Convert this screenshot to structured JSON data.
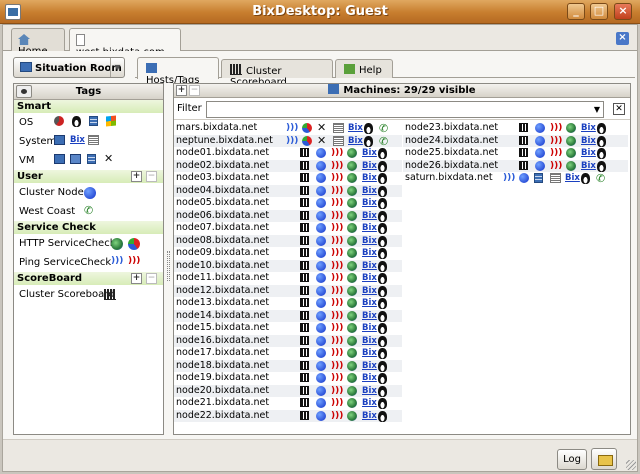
{
  "window": {
    "title": "BixDesktop: Guest"
  },
  "tabs": [
    {
      "label": "Home"
    },
    {
      "label": "west.bixdata.com"
    }
  ],
  "toolbar": {
    "situation_room": "Situation Room"
  },
  "inner_tabs": [
    {
      "label": "Hosts/Tags"
    },
    {
      "label": "Cluster Scoreboard"
    },
    {
      "label": "Help"
    }
  ],
  "tags": {
    "header": "Tags",
    "sections": {
      "smart": "Smart",
      "user": "User",
      "service_check": "Service Check",
      "scoreboard": "ScoreBoard"
    },
    "rows": {
      "os": "OS",
      "system": "System",
      "vm": "VM",
      "cluster_nodes": "Cluster Nodes",
      "west_coast": "West Coast",
      "http_check": "HTTP ServiceCheck",
      "ping_check": "Ping ServiceCheck",
      "cluster_scoreboard": "Cluster Scoreboard"
    },
    "bix_label": "Bix"
  },
  "machines": {
    "header": "Machines: 29/29 visible",
    "filter_label": "Filter",
    "filter_value": "",
    "bix_label": "Bix",
    "col1": [
      {
        "name": "mars.bixdata.net",
        "kind": "special"
      },
      {
        "name": "neptune.bixdata.net",
        "kind": "special"
      },
      {
        "name": "node01.bixdata.net",
        "kind": "node"
      },
      {
        "name": "node02.bixdata.net",
        "kind": "node"
      },
      {
        "name": "node03.bixdata.net",
        "kind": "node"
      },
      {
        "name": "node04.bixdata.net",
        "kind": "node"
      },
      {
        "name": "node05.bixdata.net",
        "kind": "node"
      },
      {
        "name": "node06.bixdata.net",
        "kind": "node"
      },
      {
        "name": "node07.bixdata.net",
        "kind": "node"
      },
      {
        "name": "node08.bixdata.net",
        "kind": "node"
      },
      {
        "name": "node09.bixdata.net",
        "kind": "node"
      },
      {
        "name": "node10.bixdata.net",
        "kind": "node"
      },
      {
        "name": "node11.bixdata.net",
        "kind": "node"
      },
      {
        "name": "node12.bixdata.net",
        "kind": "node"
      },
      {
        "name": "node13.bixdata.net",
        "kind": "node"
      },
      {
        "name": "node14.bixdata.net",
        "kind": "node"
      },
      {
        "name": "node15.bixdata.net",
        "kind": "node"
      },
      {
        "name": "node16.bixdata.net",
        "kind": "node"
      },
      {
        "name": "node17.bixdata.net",
        "kind": "node"
      },
      {
        "name": "node18.bixdata.net",
        "kind": "node"
      },
      {
        "name": "node19.bixdata.net",
        "kind": "node"
      },
      {
        "name": "node20.bixdata.net",
        "kind": "node"
      },
      {
        "name": "node21.bixdata.net",
        "kind": "node"
      },
      {
        "name": "node22.bixdata.net",
        "kind": "node"
      }
    ],
    "col2": [
      {
        "name": "node23.bixdata.net",
        "kind": "node"
      },
      {
        "name": "node24.bixdata.net",
        "kind": "node"
      },
      {
        "name": "node25.bixdata.net",
        "kind": "node"
      },
      {
        "name": "node26.bixdata.net",
        "kind": "node"
      },
      {
        "name": "saturn.bixdata.net",
        "kind": "saturn"
      }
    ]
  },
  "bottom": {
    "log": "Log"
  }
}
